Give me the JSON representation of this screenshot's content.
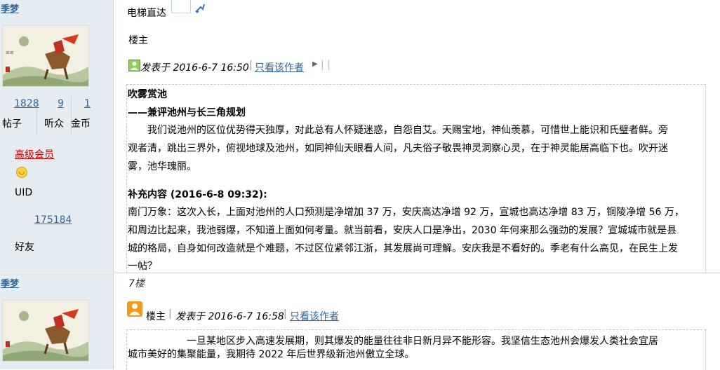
{
  "post1": {
    "username": "季梦",
    "stats": [
      {
        "value": "1828",
        "label": "帖子"
      },
      {
        "value": "9",
        "label": "听众"
      },
      {
        "value": "1",
        "label": "金币"
      }
    ],
    "rank": "高级会员",
    "uid_label": "UID",
    "uid_value": "175184",
    "friends_label": "好友",
    "elevator": "电梯直达",
    "floor": "楼主",
    "posted_at": "发表于 2016-6-7 16:50",
    "only_author": "只看该作者",
    "body": {
      "title": "吹雾赏池",
      "subtitle": "——兼评池州与长三角规划",
      "paragraph": [
        "　　我们说池州的区位优势得天独厚，对此总有人怀疑迷惑，自怨自艾。天赐宝地，神仙羡慕，可惜世上能识和氏璧者鲜。旁",
        "观者清，跳出三界外，俯视地球及池州，如同神仙天眼看人间，凡夫俗子敬畏神灵洞察心灵，在于神灵能居高临下也。吹开迷",
        "雾，池华瑰丽。"
      ],
      "supplement_title": "补充内容 (2016-6-8 09:32):",
      "supplement": [
        "南门万象：这次入长，上面对池州的人口预测是净增加 37 万，安庆高达净增 92 万，宣城也高达净增 83 万，铜陵净增 56 万，",
        "和周边比起来，我池弱爆，不知道上面如何考量。就当前看，安庆人口是净出，2030 年何来那么强劲的发展？宣城城市就是县",
        "城的格局，自身如何改造就是个难题，不过区位紧邻江浙，其发展尚可理解。安庆我是不看好的。季老有什么高见，在民生上发",
        "一帖？"
      ]
    }
  },
  "post2": {
    "username": "季梦",
    "floor": "7楼",
    "author_tag": "楼主",
    "posted_at": "发表于 2016-6-7 16:58",
    "only_author": "只看该作者",
    "body": [
      "　　　　　　一旦某地区步入高速发展期，则其爆发的能量往往非日新月异不能形容。我坚信生态池州会爆发人类社会宜居",
      "城市美好的集聚能量，我期待 2022 年后世界级新池州傲立全球。"
    ]
  },
  "colors": {
    "sidebar_bg": "#e5edf2",
    "link": "#336699",
    "rank": "#cc0000",
    "border": "#c2d5e3"
  }
}
